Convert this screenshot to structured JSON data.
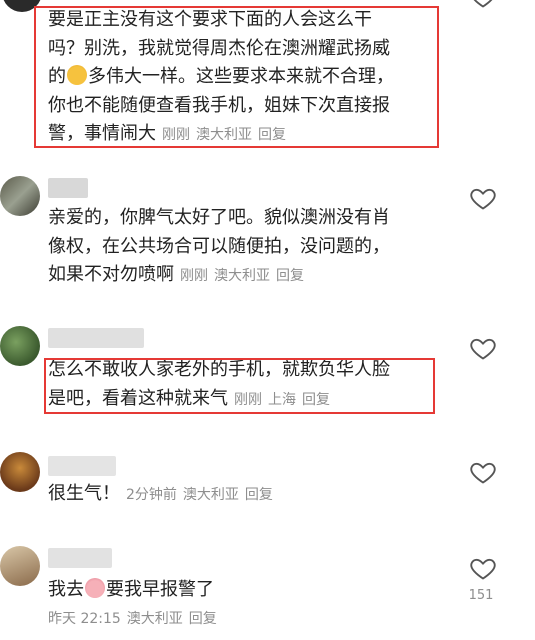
{
  "comments": [
    {
      "text_lines": [
        "要是正主没有这个要求下面的人会这么干",
        "吗？别洗，我就觉得周杰伦在澳洲耀武扬威",
        "的",
        "多伟大一样。这些要求本来就不合理，",
        "你也不能随便查看我手机，姐妹下次直接报",
        "警，事情闹大"
      ],
      "emoji": "smiling-face-emoji",
      "time": "刚刚",
      "location": "澳大利亚",
      "reply_label": "回复"
    },
    {
      "text_lines": [
        "亲爱的，你脾气太好了吧。貌似澳洲没有肖",
        "像权，在公共场合可以随便拍，没问题的，",
        "如果不对勿喷啊"
      ],
      "time": "刚刚",
      "location": "澳大利亚",
      "reply_label": "回复"
    },
    {
      "text_lines": [
        "怎么不敢收人家老外的手机，就欺负华人脸",
        "是吧，看着这种就来气"
      ],
      "time": "刚刚",
      "location": "上海",
      "reply_label": "回复"
    },
    {
      "text_lines": [
        "很生气！"
      ],
      "time": "2分钟前",
      "location": "澳大利亚",
      "reply_label": "回复"
    },
    {
      "text_lines": [
        "我去",
        "要我早报警了"
      ],
      "emoji": "crying-face-emoji",
      "time": "昨天 22:15",
      "location": "澳大利亚",
      "reply_label": "回复",
      "like_count": "151"
    }
  ],
  "colors": {
    "highlight": "#e53935",
    "meta": "#8e8e8e",
    "text": "#222222"
  }
}
